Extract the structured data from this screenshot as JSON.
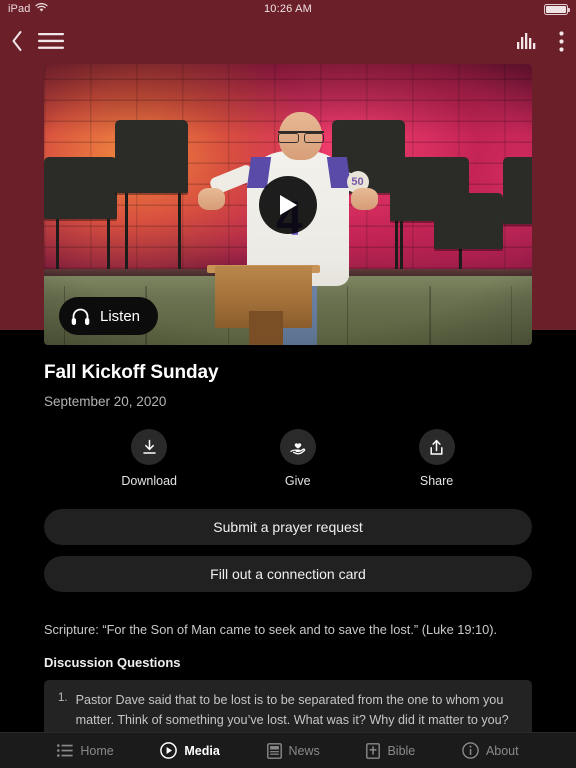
{
  "status_bar": {
    "carrier": "iPad",
    "wifi_icon": "wifi-icon",
    "time": "10:26 AM",
    "battery_icon": "battery-full-icon"
  },
  "nav_bar": {
    "background_color": "#6b2029",
    "back_icon": "chevron-left-icon",
    "menu_icon": "hamburger-menu-icon",
    "audio_icon": "equalizer-bars-icon",
    "overflow_icon": "more-vertical-icon"
  },
  "video": {
    "play_icon": "play-icon",
    "listen_label": "Listen",
    "listen_icon": "headphones-icon"
  },
  "sermon": {
    "title": "Fall Kickoff Sunday",
    "date": "September 20, 2020"
  },
  "actions": [
    {
      "label": "Download",
      "icon": "download-icon"
    },
    {
      "label": "Give",
      "icon": "hand-heart-icon"
    },
    {
      "label": "Share",
      "icon": "share-upload-icon"
    }
  ],
  "buttons": {
    "prayer_request": "Submit a prayer request",
    "connection_card": "Fill out a connection card"
  },
  "body": {
    "scripture": "Scripture: “For the Son of Man came to seek and to save the lost.”  (Luke 19:10).",
    "discussion_heading": "Discussion Questions",
    "questions": [
      {
        "number": "1.",
        "text": "Pastor Dave said that to be lost is to be separated from the one to whom you matter.  Think of something you’ve lost. What was it? Why did it matter to you? Did you go searching for it? Did you find it?"
      }
    ]
  },
  "tabs": [
    {
      "label": "Home",
      "icon": "list-icon",
      "active": false
    },
    {
      "label": "Media",
      "icon": "play-circle-icon",
      "active": true
    },
    {
      "label": "News",
      "icon": "newspaper-icon",
      "active": false
    },
    {
      "label": "Bible",
      "icon": "book-cross-icon",
      "active": false
    },
    {
      "label": "About",
      "icon": "info-circle-icon",
      "active": false
    }
  ],
  "colors": {
    "brand_maroon": "#6b2029",
    "page_background": "#000000",
    "card_background": "#232323",
    "button_background": "#212121"
  }
}
